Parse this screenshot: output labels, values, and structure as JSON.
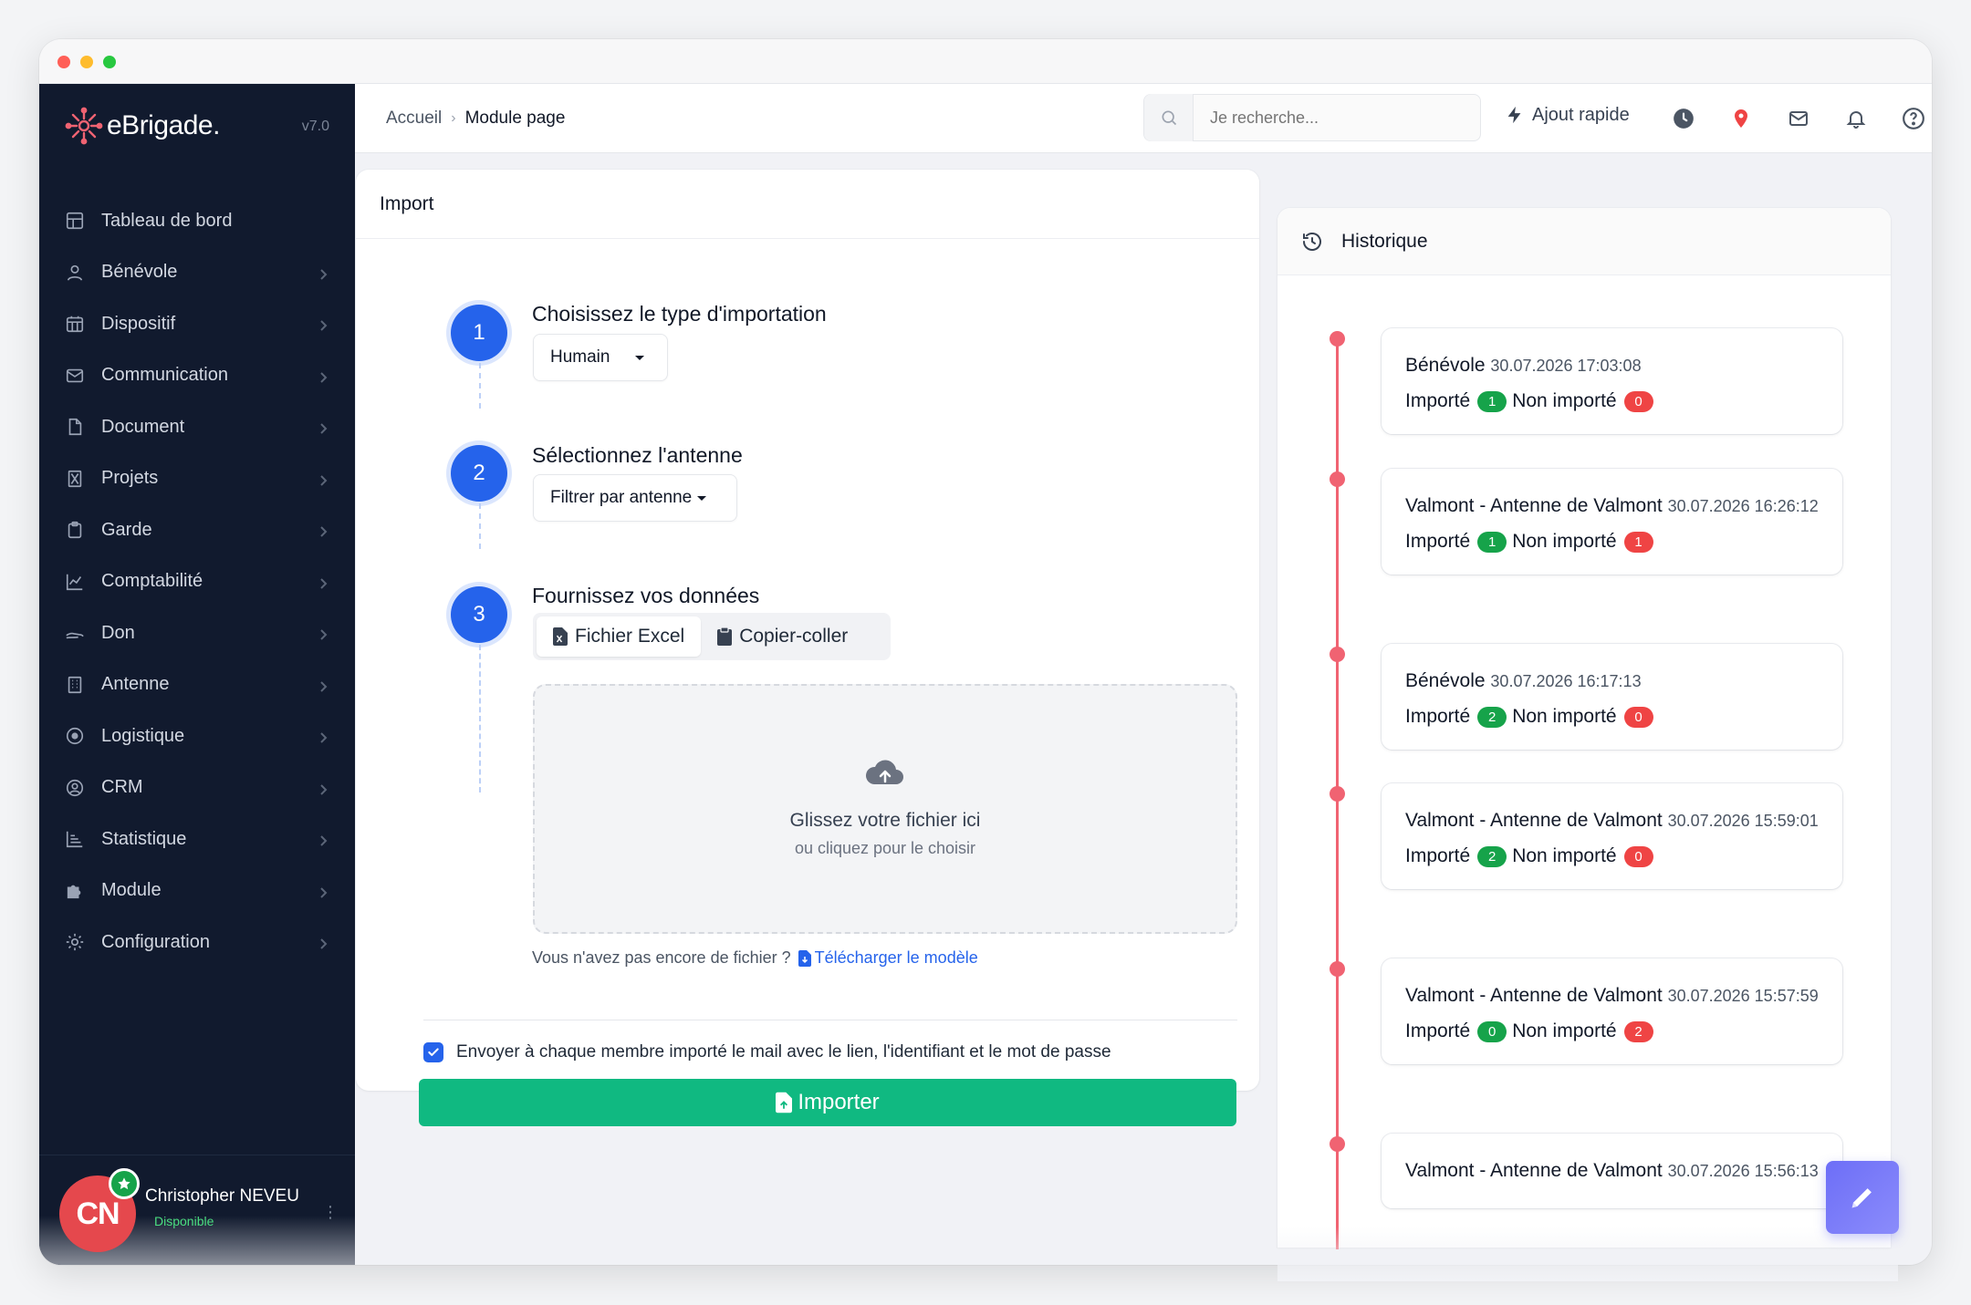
{
  "app": {
    "brand": "eBrigade.",
    "version": "v7.0"
  },
  "sidebar": {
    "items": [
      {
        "label": "Tableau de bord",
        "icon": "dashboard-icon",
        "has_children": false
      },
      {
        "label": "Bénévole",
        "icon": "user-icon",
        "has_children": true
      },
      {
        "label": "Dispositif",
        "icon": "calendar-grid-icon",
        "has_children": true
      },
      {
        "label": "Communication",
        "icon": "envelope-icon",
        "has_children": true
      },
      {
        "label": "Document",
        "icon": "file-icon",
        "has_children": true
      },
      {
        "label": "Projets",
        "icon": "hourglass-icon",
        "has_children": true
      },
      {
        "label": "Garde",
        "icon": "clipboard-icon",
        "has_children": true
      },
      {
        "label": "Comptabilité",
        "icon": "chart-line-icon",
        "has_children": true
      },
      {
        "label": "Don",
        "icon": "hand-icon",
        "has_children": true
      },
      {
        "label": "Antenne",
        "icon": "building-icon",
        "has_children": true
      },
      {
        "label": "Logistique",
        "icon": "target-icon",
        "has_children": true
      },
      {
        "label": "CRM",
        "icon": "user-circle-icon",
        "has_children": true
      },
      {
        "label": "Statistique",
        "icon": "bar-list-icon",
        "has_children": true
      },
      {
        "label": "Module",
        "icon": "puzzle-icon",
        "has_children": true
      },
      {
        "label": "Configuration",
        "icon": "gear-icon",
        "has_children": true
      }
    ]
  },
  "user": {
    "initials": "CN",
    "name": "Christopher NEVEU",
    "status": "Disponible"
  },
  "topbar": {
    "breadcrumb": {
      "home": "Accueil",
      "current": "Module page"
    },
    "search_placeholder": "Je recherche...",
    "quick_add": "Ajout rapide"
  },
  "import": {
    "header": "Import",
    "step1": {
      "number": "1",
      "title": "Choisissez le type d'importation",
      "selected": "Humain"
    },
    "step2": {
      "number": "2",
      "title": "Sélectionnez l'antenne",
      "selected": "Filtrer par antenne"
    },
    "step3": {
      "number": "3",
      "title": "Fournissez vos données",
      "tabs": [
        "Fichier Excel",
        "Copier-coller"
      ],
      "dropzone_title": "Glissez votre fichier ici",
      "dropzone_sub": "ou cliquez pour le choisir",
      "no_file_text": "Vous n'avez pas encore de fichier ?",
      "download_link": "Télécharger le modèle"
    },
    "send_mail_label": "Envoyer à chaque membre importé le mail avec le lien, l'identifiant et le mot de passe",
    "send_mail_checked": true,
    "button": "Importer"
  },
  "history": {
    "header": "Historique",
    "imported_label": "Importé",
    "not_imported_label": "Non importé",
    "entries": [
      {
        "title": "Bénévole",
        "date": "30.07.2026 17:03:08",
        "imported": "1",
        "not_imported": "0"
      },
      {
        "title": "Valmont - Antenne de Valmont",
        "date": "30.07.2026 16:26:12",
        "imported": "1",
        "not_imported": "1"
      },
      {
        "title": "Bénévole",
        "date": "30.07.2026 16:17:13",
        "imported": "2",
        "not_imported": "0"
      },
      {
        "title": "Valmont - Antenne de Valmont",
        "date": "30.07.2026 15:59:01",
        "imported": "2",
        "not_imported": "0"
      },
      {
        "title": "Valmont - Antenne de Valmont",
        "date": "30.07.2026 15:57:59",
        "imported": "0",
        "not_imported": "2"
      },
      {
        "title": "Valmont - Antenne de Valmont",
        "date": "30.07.2026 15:56:13",
        "imported": "",
        "not_imported": ""
      }
    ]
  },
  "colors": {
    "sidebar": "#111a2e",
    "primary": "#2563eb",
    "success": "#10b981",
    "danger": "#ef4444",
    "timeline": "#f06372"
  }
}
